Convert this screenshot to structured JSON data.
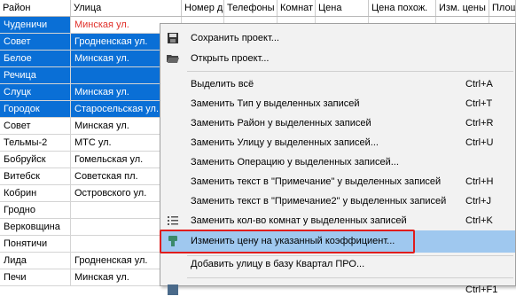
{
  "columns": [
    "Район",
    "Улица",
    "Номер д",
    "Телефоны",
    "Комнат",
    "Цена",
    "Цена похож.",
    "Изм. цены",
    "Площ"
  ],
  "rows": [
    {
      "district": "Чуденичи",
      "street": "Минская ул.",
      "selected": true,
      "street_red": true,
      "street_white": true
    },
    {
      "district": "Совет",
      "street": "Гродненская ул.",
      "selected": true
    },
    {
      "district": "Белое",
      "street": "Минская ул.",
      "selected": true
    },
    {
      "district": "Речица",
      "street": "",
      "selected": true
    },
    {
      "district": "Слуцк",
      "street": "Минская ул.",
      "selected": true
    },
    {
      "district": "Городок",
      "street": "Старосельская ул.",
      "selected": true
    },
    {
      "district": "Совет",
      "street": "Минская ул.",
      "selected": false
    },
    {
      "district": "Тельмы-2",
      "street": "МТС ул.",
      "selected": false
    },
    {
      "district": "Бобруйск",
      "street": "Гомельская ул.",
      "selected": false
    },
    {
      "district": "Витебск",
      "street": "Советская пл.",
      "selected": false
    },
    {
      "district": "Кобрин",
      "street": "Островского ул.",
      "selected": false
    },
    {
      "district": "Гродно",
      "street": "",
      "selected": false
    },
    {
      "district": "Верковщина",
      "street": "",
      "selected": false
    },
    {
      "district": "Понятичи",
      "street": "",
      "selected": false
    },
    {
      "district": "Лида",
      "street": "Гродненская ул.",
      "selected": false
    },
    {
      "district": "Печи",
      "street": "Минская ул.",
      "selected": false
    }
  ],
  "menu": {
    "save_project": "Сохранить проект...",
    "open_project": "Открыть проект...",
    "select_all": "Выделить всё",
    "select_all_sc": "Ctrl+A",
    "replace_type": "Заменить Тип у выделенных записей",
    "replace_type_sc": "Ctrl+T",
    "replace_district": "Заменить Район у выделенных записей",
    "replace_district_sc": "Ctrl+R",
    "replace_street": "Заменить Улицу у выделенных записей...",
    "replace_street_sc": "Ctrl+U",
    "replace_operation": "Заменить Операцию у выделенных записей...",
    "replace_note": "Заменить текст в \"Примечание\" у выделенных записей",
    "replace_note_sc": "Ctrl+H",
    "replace_note2": "Заменить текст в \"Примечание2\" у выделенных записей",
    "replace_note2_sc": "Ctrl+J",
    "replace_rooms": "Заменить кол-во комнат у выделенных записей",
    "replace_rooms_sc": "Ctrl+K",
    "change_price": "Изменить цену на указанный коэффициент...",
    "add_street": "Добавить улицу в базу Квартал ПРО...",
    "last_sc": "Ctrl+F1"
  },
  "colors": {
    "selection": "#0a6fd6",
    "highlight": "#9fc8ef",
    "callout": "#e01c1c"
  }
}
